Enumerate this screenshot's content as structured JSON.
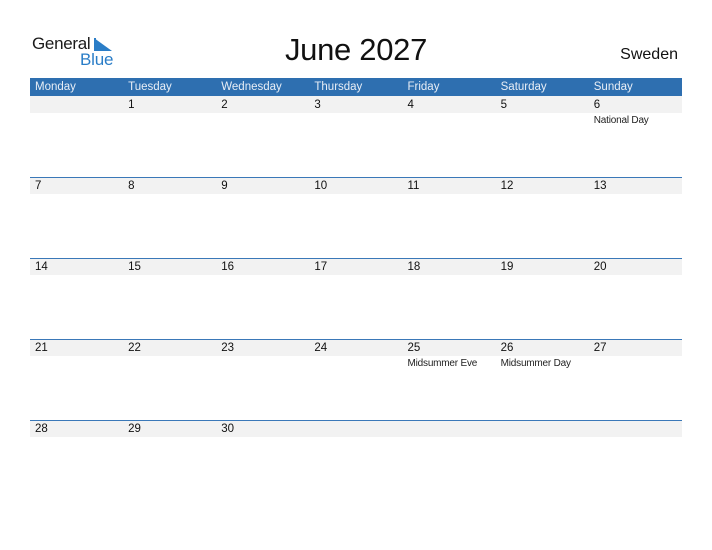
{
  "logo": {
    "line1": "General",
    "line2": "Blue"
  },
  "title": "June 2027",
  "country": "Sweden",
  "colors": {
    "header_bg": "#2e6fb0",
    "accent": "#2a7dc7",
    "strip": "#f2f2f2"
  },
  "weekdays": [
    "Monday",
    "Tuesday",
    "Wednesday",
    "Thursday",
    "Friday",
    "Saturday",
    "Sunday"
  ],
  "weeks": [
    [
      {
        "day": "",
        "holiday": ""
      },
      {
        "day": "1",
        "holiday": ""
      },
      {
        "day": "2",
        "holiday": ""
      },
      {
        "day": "3",
        "holiday": ""
      },
      {
        "day": "4",
        "holiday": ""
      },
      {
        "day": "5",
        "holiday": ""
      },
      {
        "day": "6",
        "holiday": "National Day"
      }
    ],
    [
      {
        "day": "7",
        "holiday": ""
      },
      {
        "day": "8",
        "holiday": ""
      },
      {
        "day": "9",
        "holiday": ""
      },
      {
        "day": "10",
        "holiday": ""
      },
      {
        "day": "11",
        "holiday": ""
      },
      {
        "day": "12",
        "holiday": ""
      },
      {
        "day": "13",
        "holiday": ""
      }
    ],
    [
      {
        "day": "14",
        "holiday": ""
      },
      {
        "day": "15",
        "holiday": ""
      },
      {
        "day": "16",
        "holiday": ""
      },
      {
        "day": "17",
        "holiday": ""
      },
      {
        "day": "18",
        "holiday": ""
      },
      {
        "day": "19",
        "holiday": ""
      },
      {
        "day": "20",
        "holiday": ""
      }
    ],
    [
      {
        "day": "21",
        "holiday": ""
      },
      {
        "day": "22",
        "holiday": ""
      },
      {
        "day": "23",
        "holiday": ""
      },
      {
        "day": "24",
        "holiday": ""
      },
      {
        "day": "25",
        "holiday": "Midsummer Eve"
      },
      {
        "day": "26",
        "holiday": "Midsummer Day"
      },
      {
        "day": "27",
        "holiday": ""
      }
    ],
    [
      {
        "day": "28",
        "holiday": ""
      },
      {
        "day": "29",
        "holiday": ""
      },
      {
        "day": "30",
        "holiday": ""
      },
      {
        "day": "",
        "holiday": ""
      },
      {
        "day": "",
        "holiday": ""
      },
      {
        "day": "",
        "holiday": ""
      },
      {
        "day": "",
        "holiday": ""
      }
    ]
  ]
}
